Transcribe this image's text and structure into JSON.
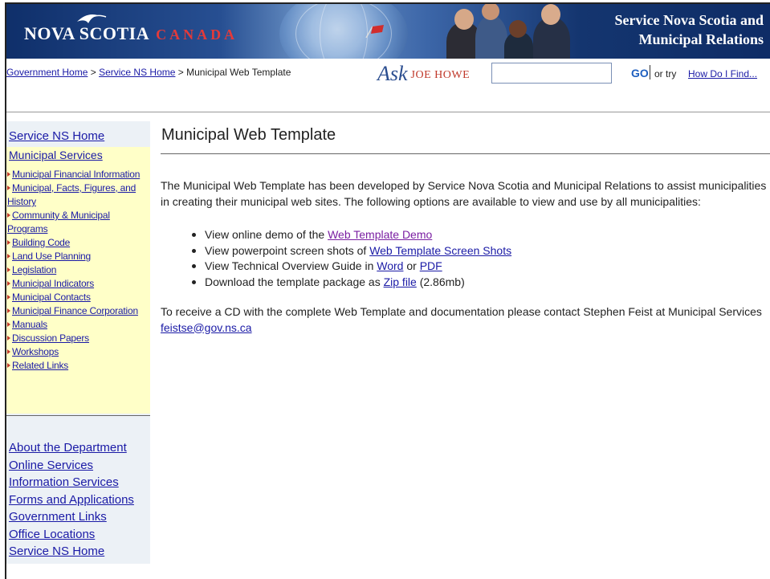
{
  "banner": {
    "logo_text": "NOVA SCOTIA",
    "logo_canada": "CANADA",
    "title_line1": "Service Nova Scotia and",
    "title_line2": "Municipal Relations"
  },
  "breadcrumb": {
    "gov_home": "Government Home",
    "sep": " > ",
    "sns_home": "Service NS Home",
    "current": "Municipal Web Template"
  },
  "search": {
    "ask_script": "Ask",
    "ask_name": "JOE HOWE",
    "input_value": "",
    "go_label": "GO",
    "or_try": "or try",
    "how_do_link": "How Do I Find..."
  },
  "sidebar": {
    "home_link": "Service NS Home",
    "services_title": "Municipal Services",
    "services_items": [
      "Municipal Financial Information",
      "Municipal, Facts, Figures, and History",
      "Community & Municipal Programs",
      "Building Code",
      "Land Use Planning",
      "Legislation",
      "Municipal Indicators",
      "Municipal Contacts",
      "Municipal Finance Corporation",
      "Manuals",
      "Discussion Papers",
      "Workshops",
      "Related Links"
    ],
    "bottom_links": [
      "About the Department",
      "Online Services",
      "Information Services",
      "Forms and Applications",
      "Government Links",
      "Office Locations",
      "Service NS Home"
    ]
  },
  "main": {
    "title": "Municipal Web Template",
    "intro": "The Municipal Web Template has been developed by Service Nova Scotia and Municipal Relations to assist municipalities in creating their municipal web sites. The following options are available to view and use by all municipalities:",
    "options": [
      {
        "prefix": "View online demo of the ",
        "link": "Web Template Demo"
      },
      {
        "prefix": "View powerpoint screen shots of ",
        "link": "Web Template Screen Shots"
      },
      {
        "prefix": "View Technical Overview Guide in ",
        "link": "Word",
        "mid": " or ",
        "link2": "PDF"
      },
      {
        "prefix": "Download the template package as ",
        "link": "Zip file",
        "suffix": " (2.86mb)"
      }
    ],
    "contact_text": "To receive a CD with the complete Web Template and documentation please contact Stephen Feist at Municipal Services ",
    "contact_email": "feistse@gov.ns.ca"
  }
}
